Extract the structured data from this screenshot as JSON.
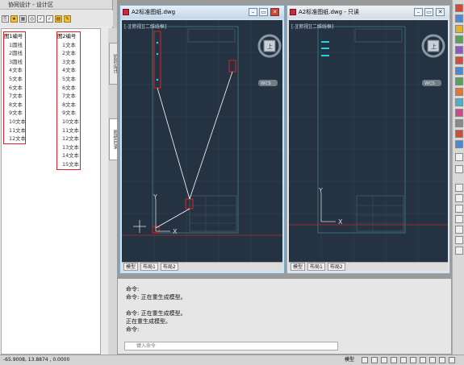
{
  "panel": {
    "title": "协同设计 - 设计区"
  },
  "tree1": {
    "root": "图1编号",
    "items": [
      "1圆线",
      "2圆线",
      "3圆线",
      "4文本",
      "5文本",
      "6文本",
      "7文本",
      "8文本",
      "9文本",
      "10文本",
      "11文本",
      "12文本"
    ]
  },
  "tree2": {
    "root": "图2编号",
    "items": [
      "1文本",
      "2文本",
      "3文本",
      "4文本",
      "5文本",
      "6文本",
      "7文本",
      "8文本",
      "9文本",
      "10文本",
      "11文本",
      "12文本",
      "13文本",
      "14文本",
      "15文本"
    ]
  },
  "vtabs": {
    "t1": "协同设计",
    "t2": "图纸目录"
  },
  "win1": {
    "title": "A2标准图纸.dwg",
    "view_label": "[-][俯视][二维线框]",
    "wcs": "WCS",
    "tabs": [
      "模型",
      "布局1",
      "布局2"
    ]
  },
  "win2": {
    "title": "A2标准图纸.dwg - 只读",
    "view_label": "[-][俯视][二维线框]",
    "wcs": "WCS",
    "tabs": [
      "模型",
      "布局1",
      "布局2"
    ]
  },
  "nav": {
    "top": "上",
    "n": "北",
    "s": "南",
    "w": "西",
    "e": "东"
  },
  "axis": {
    "x": "X",
    "y": "Y"
  },
  "cmd": {
    "history": "命令:\n命令: 正在重生成模型。\n\n命令: 正在重生成模型。\n正在重生成模型。\n命令:",
    "placeholder": "键入命令"
  },
  "status": {
    "coords": "-65.9008, 13.8874 , 0.0000",
    "model": "模型"
  },
  "colors": {
    "viewport": "#253242",
    "highlight": "#e02020",
    "cyan": "#19d6e0"
  }
}
